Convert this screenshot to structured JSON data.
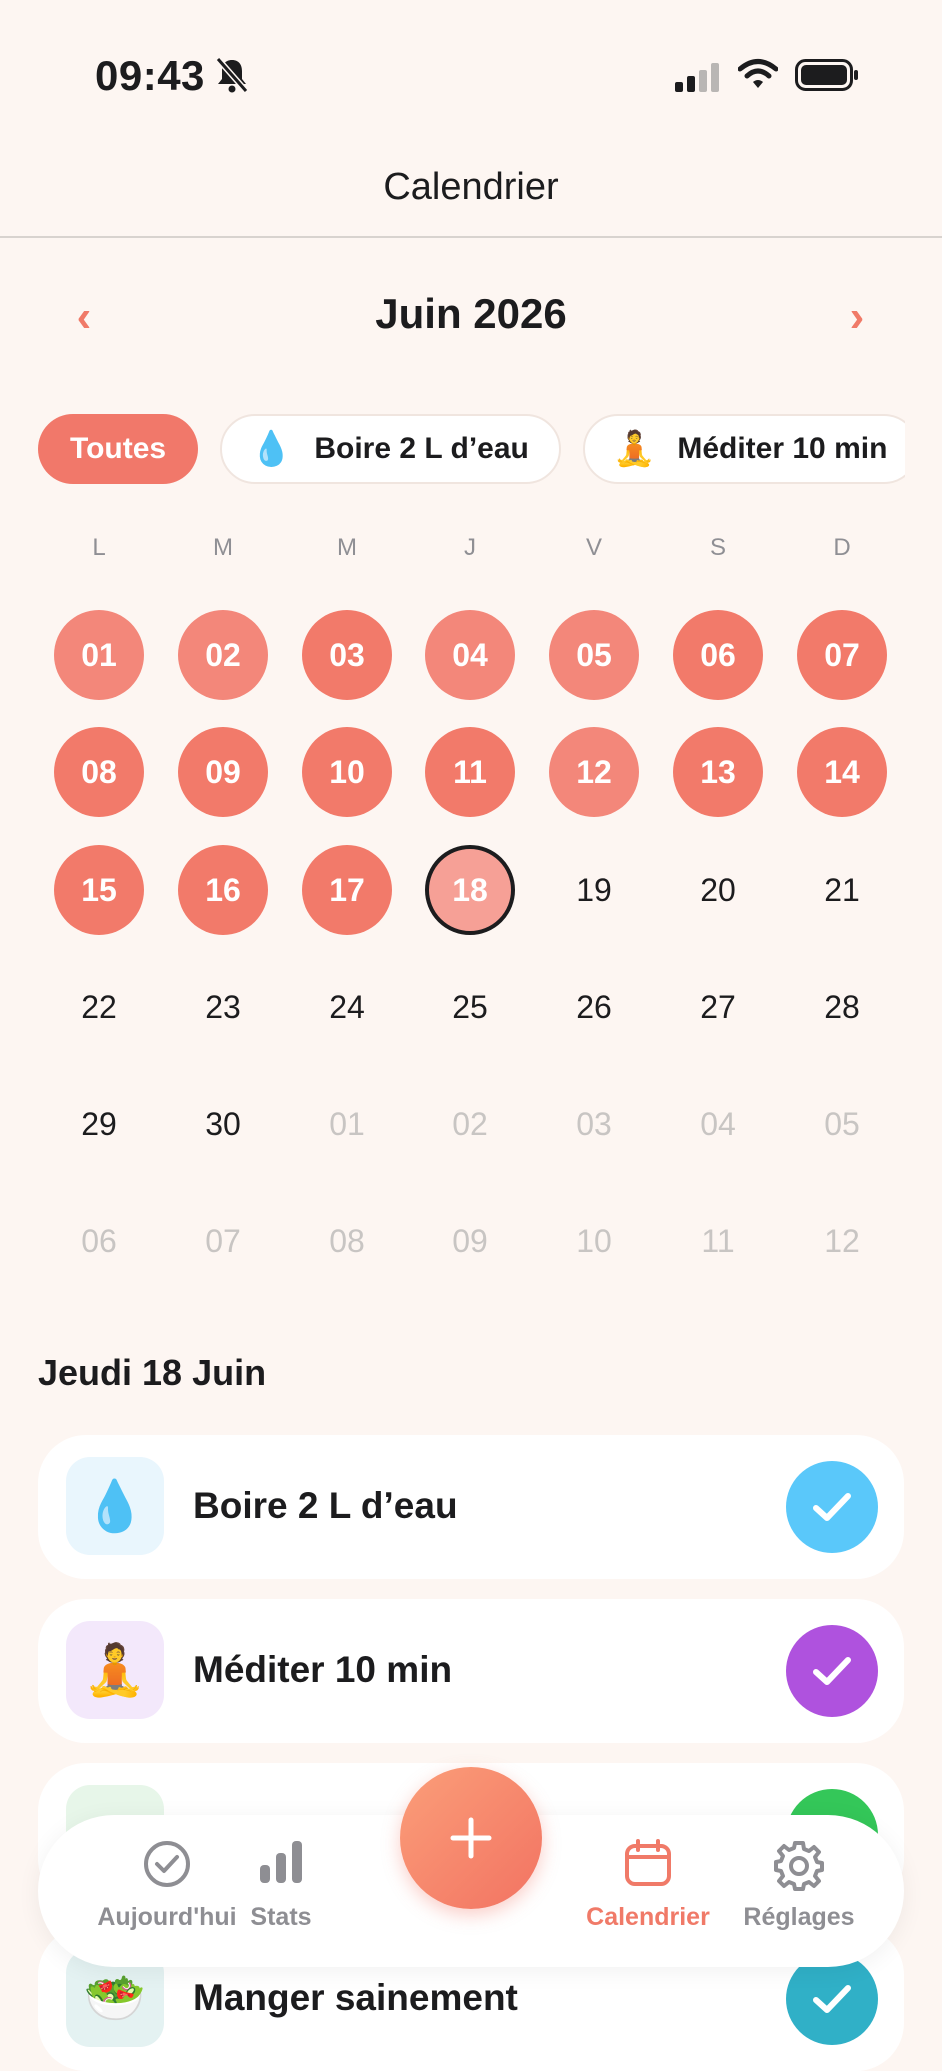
{
  "status_bar": {
    "time": "09:43"
  },
  "nav": {
    "title": "Calendrier"
  },
  "calendar": {
    "month_label": "Juin 2026",
    "weekdays": [
      "L",
      "M",
      "M",
      "J",
      "V",
      "S",
      "D"
    ],
    "weeks": [
      [
        {
          "t": "01",
          "s": "d80"
        },
        {
          "t": "02",
          "s": "d80"
        },
        {
          "t": "03",
          "s": "d100"
        },
        {
          "t": "04",
          "s": "d80"
        },
        {
          "t": "05",
          "s": "d80"
        },
        {
          "t": "06",
          "s": "d100"
        },
        {
          "t": "07",
          "s": "d100"
        }
      ],
      [
        {
          "t": "08",
          "s": "d100"
        },
        {
          "t": "09",
          "s": "d100"
        },
        {
          "t": "10",
          "s": "d100"
        },
        {
          "t": "11",
          "s": "d100"
        },
        {
          "t": "12",
          "s": "d80"
        },
        {
          "t": "13",
          "s": "d100"
        },
        {
          "t": "14",
          "s": "d100"
        }
      ],
      [
        {
          "t": "15",
          "s": "d100"
        },
        {
          "t": "16",
          "s": "d100"
        },
        {
          "t": "17",
          "s": "d100"
        },
        {
          "t": "18",
          "s": "today"
        },
        {
          "t": "19",
          "s": "plain"
        },
        {
          "t": "20",
          "s": "plain"
        },
        {
          "t": "21",
          "s": "plain"
        }
      ],
      [
        {
          "t": "22",
          "s": "plain"
        },
        {
          "t": "23",
          "s": "plain"
        },
        {
          "t": "24",
          "s": "plain"
        },
        {
          "t": "25",
          "s": "plain"
        },
        {
          "t": "26",
          "s": "plain"
        },
        {
          "t": "27",
          "s": "plain"
        },
        {
          "t": "28",
          "s": "plain"
        }
      ],
      [
        {
          "t": "29",
          "s": "plain"
        },
        {
          "t": "30",
          "s": "plain"
        },
        {
          "t": "01",
          "s": "out"
        },
        {
          "t": "02",
          "s": "out"
        },
        {
          "t": "03",
          "s": "out"
        },
        {
          "t": "04",
          "s": "out"
        },
        {
          "t": "05",
          "s": "out"
        }
      ],
      [
        {
          "t": "06",
          "s": "out"
        },
        {
          "t": "07",
          "s": "out"
        },
        {
          "t": "08",
          "s": "out"
        },
        {
          "t": "09",
          "s": "out"
        },
        {
          "t": "10",
          "s": "out"
        },
        {
          "t": "11",
          "s": "out"
        },
        {
          "t": "12",
          "s": "out"
        }
      ]
    ]
  },
  "filters": {
    "all": "Toutes",
    "chips": [
      {
        "emoji": "💧",
        "label": "Boire 2 L d’eau"
      },
      {
        "emoji": "🧘",
        "label": "Méditer 10 min"
      }
    ]
  },
  "selected_day": {
    "title": "Jeudi 18 Juin",
    "habits": [
      {
        "emoji": "💧",
        "label": "Boire 2 L d’eau",
        "icon_bg": "#e9f6fd",
        "check_color": "#5ac8fa"
      },
      {
        "emoji": "🧘",
        "label": "Méditer 10 min",
        "icon_bg": "#f3e8fb",
        "check_color": "#af52de"
      },
      {
        "emoji": "",
        "label": "",
        "icon_bg": "#e7f6e9",
        "check_color": "#34c759"
      },
      {
        "emoji": "🥗",
        "label": "Manger sainement",
        "icon_bg": "#e4f2f2",
        "check_color": "#30b0c7"
      }
    ]
  },
  "tabbar": {
    "today": "Aujourd'hui",
    "stats": "Stats",
    "calendar": "Calendrier",
    "settings": "Réglages"
  },
  "colors": {
    "accent": "#f27a6a"
  }
}
